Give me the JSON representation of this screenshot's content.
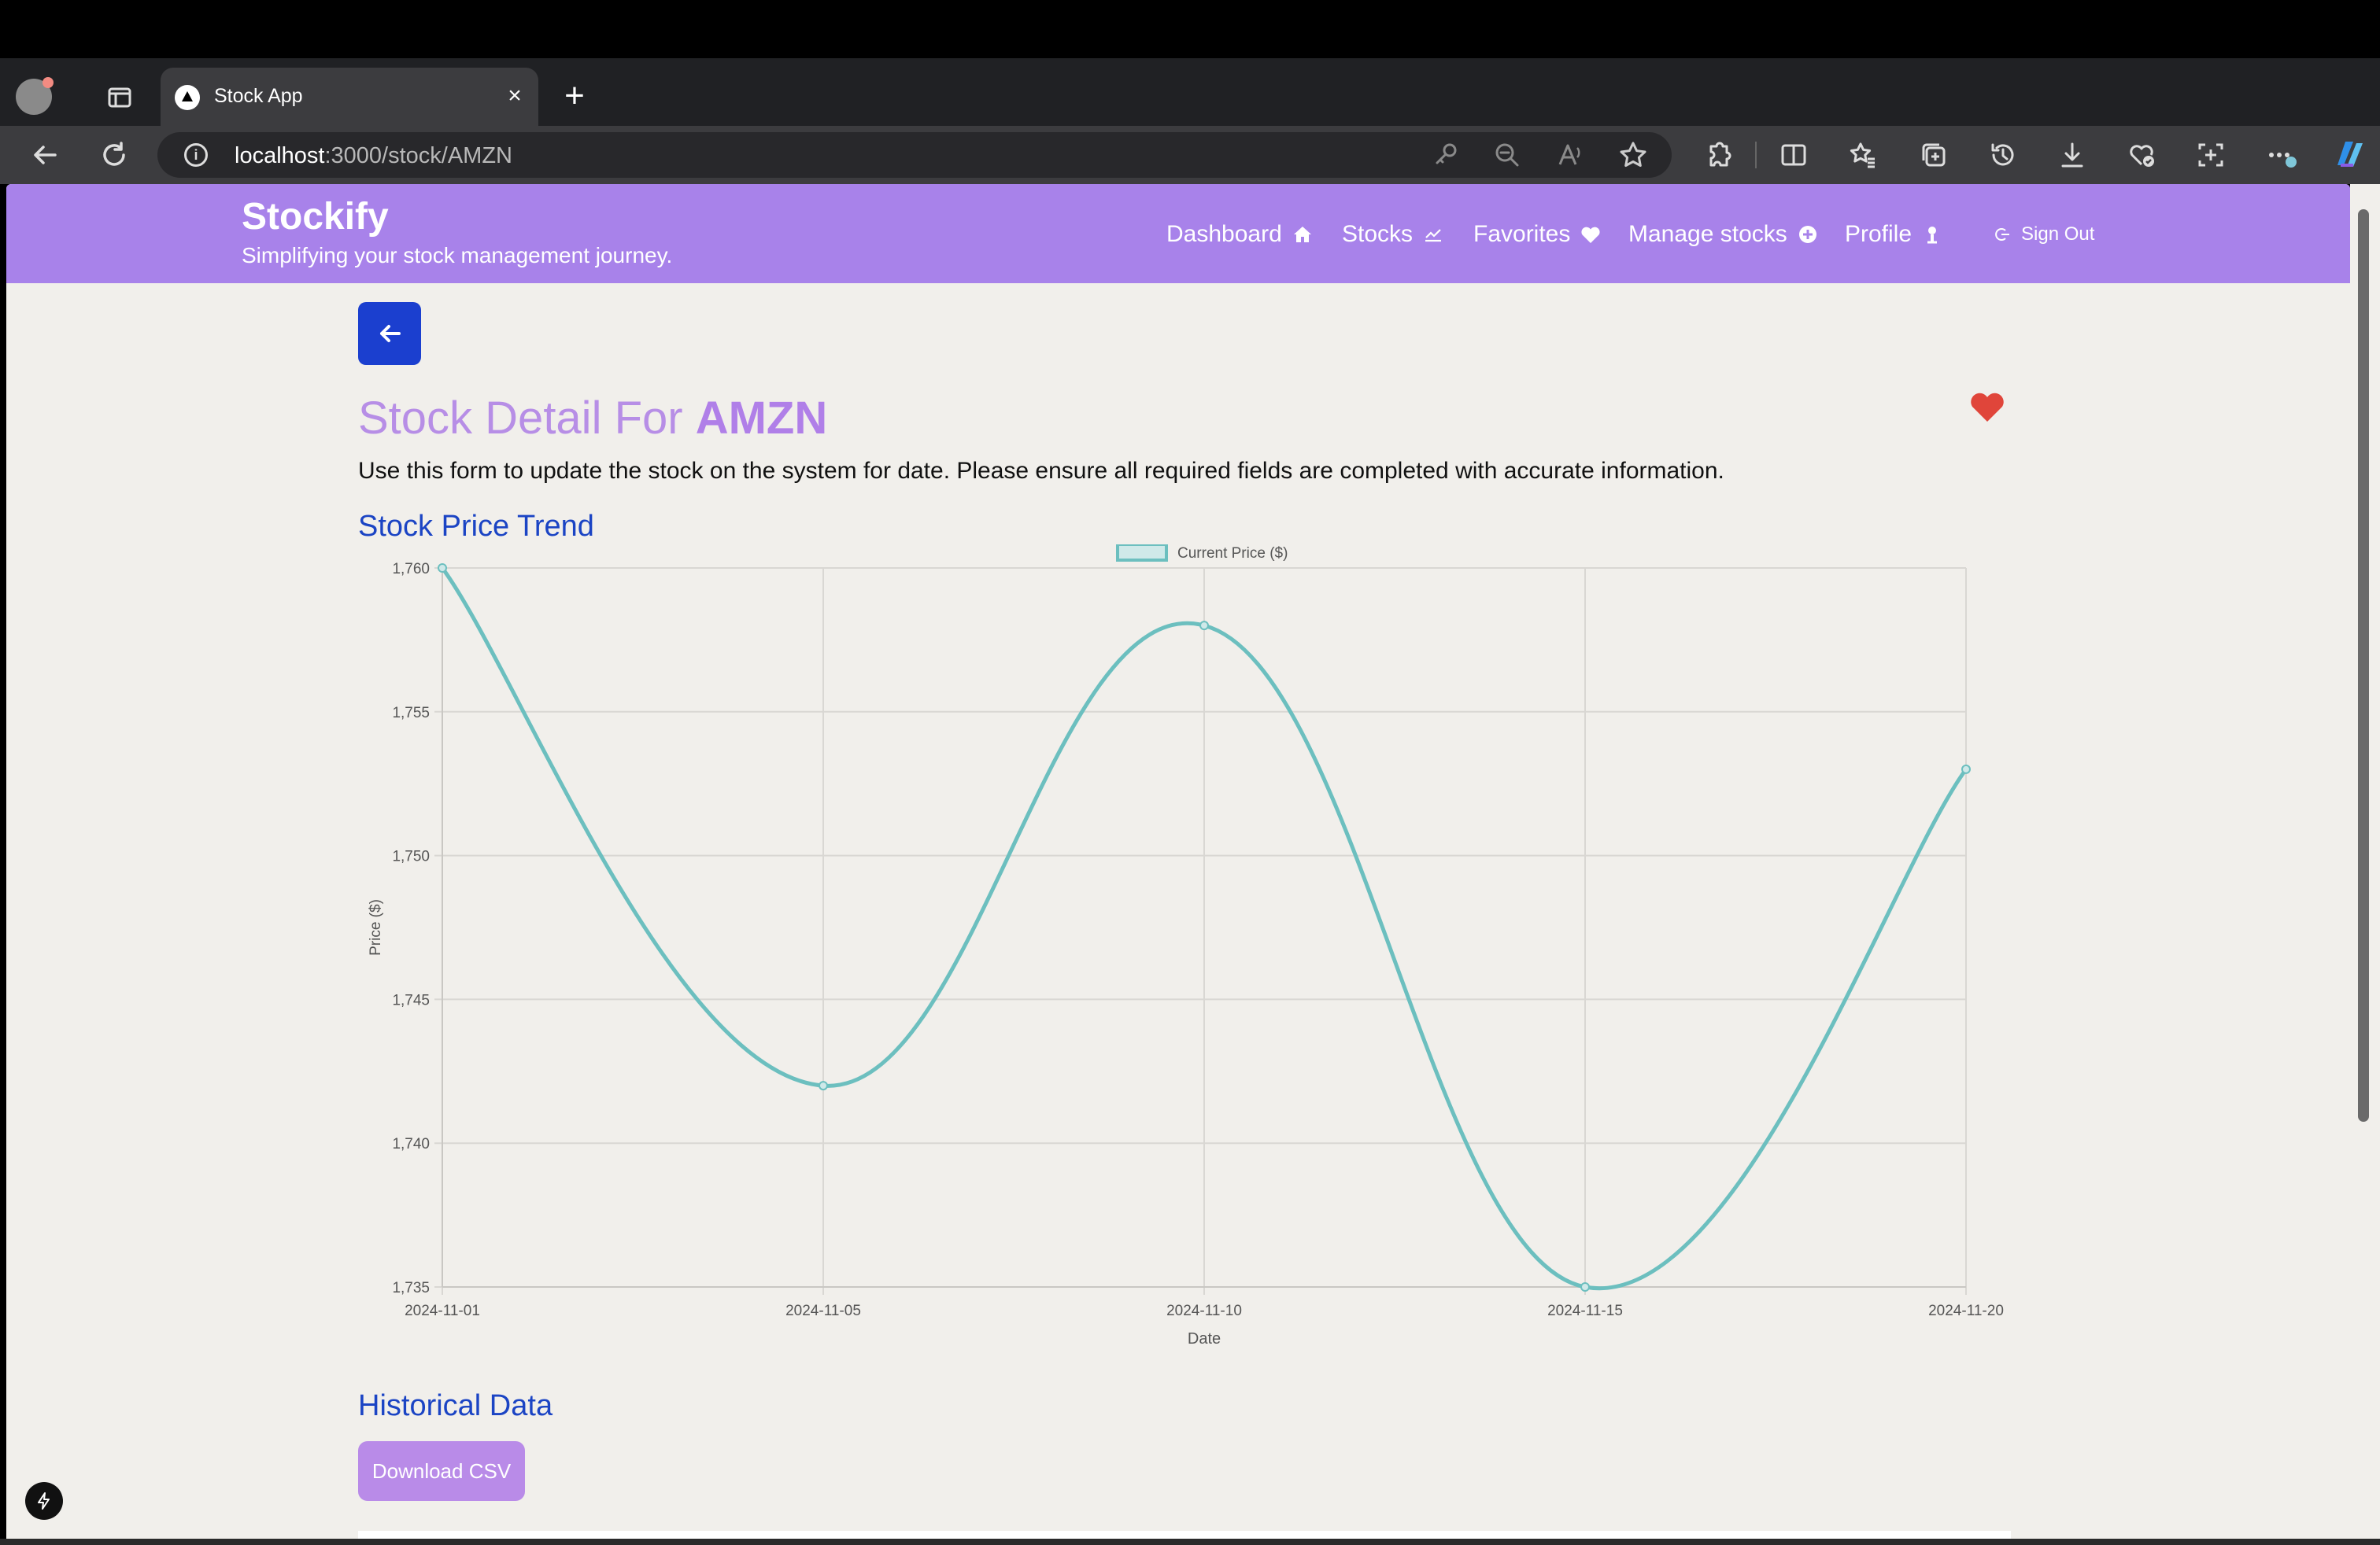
{
  "browser": {
    "tab_title": "Stock App",
    "tab_close": "×",
    "new_tab": "+",
    "url_host": "localhost",
    "url_path": ":3000/stock/AMZN",
    "info_icon": "i",
    "icons": [
      "back-icon",
      "refresh-icon",
      "key-icon",
      "zoom-out-icon",
      "read-aloud-icon",
      "star-icon",
      "extensions-icon",
      "split-screen-icon",
      "favorites-icon",
      "collections-icon",
      "history-icon",
      "downloads-icon",
      "health-icon",
      "screenshot-icon",
      "more-icon",
      "copilot-icon"
    ]
  },
  "header": {
    "brand": "Stockify",
    "tagline": "Simplifying your stock management journey.",
    "nav": [
      {
        "label": "Dashboard",
        "icon": "home-icon"
      },
      {
        "label": "Stocks",
        "icon": "chart-line-icon"
      },
      {
        "label": "Favorites",
        "icon": "heart-icon"
      },
      {
        "label": "Manage stocks",
        "icon": "plus-circle-icon"
      },
      {
        "label": "Profile",
        "icon": "user-icon"
      }
    ],
    "signout": {
      "label": "Sign Out",
      "icon": "signout-icon"
    }
  },
  "page": {
    "title_prefix": "Stock Detail For ",
    "symbol": "AMZN",
    "favorite_color": "#e0453a",
    "description": "Use this form to update the stock on the system for date. Please ensure all required fields are completed with accurate information.",
    "chart_section_title": "Stock Price Trend",
    "history_section_title": "Historical Data",
    "download_label": "Download CSV"
  },
  "colors": {
    "navbar": "#a882ea",
    "accent_blue": "#1b3fcf",
    "line": "#6cbfbf",
    "page_bg": "#f1efeb"
  },
  "chart_data": {
    "type": "line",
    "x": [
      "2024-11-01",
      "2024-11-05",
      "2024-11-10",
      "2024-11-15",
      "2024-11-20"
    ],
    "series": [
      {
        "name": "Current Price ($)",
        "values": [
          1760,
          1742,
          1758,
          1735,
          1753
        ],
        "color": "#6cbfbf"
      }
    ],
    "xlabel": "Date",
    "ylabel": "Price ($)",
    "ylim": [
      1735,
      1760
    ],
    "yticks": [
      "1,735",
      "1,740",
      "1,745",
      "1,750",
      "1,755",
      "1,760"
    ],
    "legend": "top-center",
    "grid": true
  }
}
